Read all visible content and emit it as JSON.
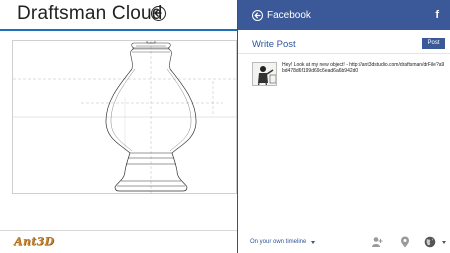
{
  "app": {
    "title": "Draftsman Cloud",
    "back_icon": "circle-arrow-left-icon",
    "logo_text": "Ant3D",
    "accent": "#1d6fb8"
  },
  "share": {
    "service_title": "Facebook",
    "brand_letter": "f",
    "brand_color": "#3b5998",
    "write_label": "Write Post",
    "post_button": "Post",
    "message": "Hey! Look at my new object! - http://ant3dstudio.com/draftsman/drFile?a9bd478d6f199d69c6ead6a6b942d0",
    "audience": "On your own timeline",
    "icons": [
      "add-person-icon",
      "location-icon",
      "globe-icon"
    ]
  }
}
